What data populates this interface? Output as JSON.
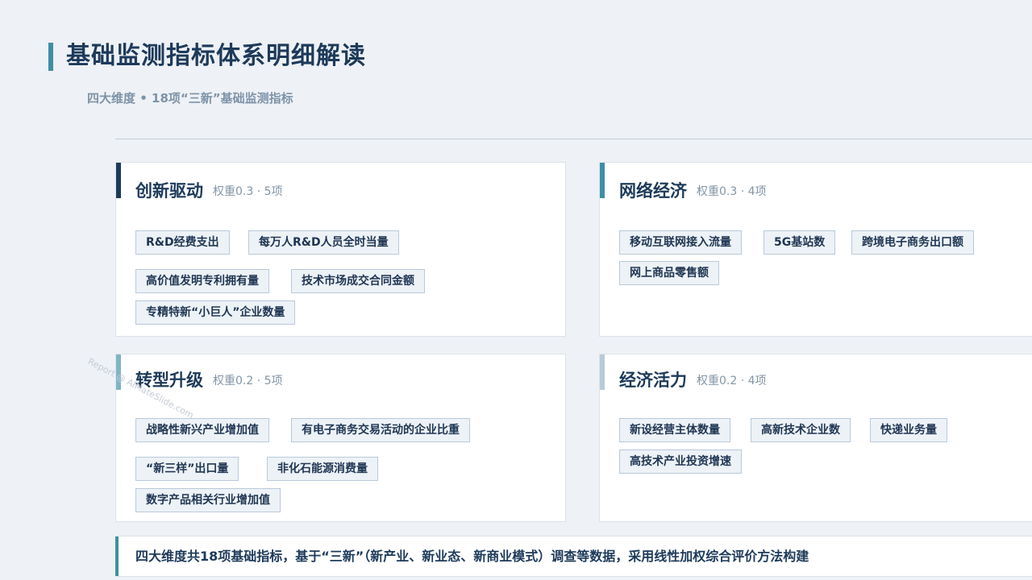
{
  "header": {
    "title": "基础监测指标体系明细解读",
    "subtitle": "四大维度 • 18项“三新”基础监测指标"
  },
  "colors": {
    "accent_teal": "#3e8fa5",
    "accent_navy": "#1d3a5a",
    "accent_light_teal": "#7fb6c6",
    "accent_pale": "#b9cad7",
    "tag_bg": "#edf2f7",
    "tag_border": "#b9c9da"
  },
  "cards": [
    {
      "title": "创新驱动",
      "meta": "权重0.3 · 5项",
      "tags": [
        "R&D经费支出",
        "每万人R&D人员全时当量",
        "高价值发明专利拥有量",
        "技术市场成交合同金额",
        "专精特新“小巨人”企业数量"
      ]
    },
    {
      "title": "网络经济",
      "meta": "权重0.3 · 4项",
      "tags": [
        "移动互联网接入流量",
        "5G基站数",
        "跨境电子商务出口额",
        "网上商品零售额"
      ]
    },
    {
      "title": "转型升级",
      "meta": "权重0.2 · 5项",
      "tags": [
        "战略性新兴产业增加值",
        "有电子商务交易活动的企业比重",
        "“新三样”出口量",
        "非化石能源消费量",
        "数字产品相关行业增加值"
      ]
    },
    {
      "title": "经济活力",
      "meta": "权重0.2 · 4项",
      "tags": [
        "新设经营主体数量",
        "高新技术企业数",
        "快递业务量",
        "高技术产业投资增速"
      ]
    }
  ],
  "footer": {
    "text": "四大维度共18项基础指标，基于“三新”（新产业、新业态、新商业模式）调查等数据，采用线性加权综合评价方法构建"
  },
  "watermark": "Report @ AIMateSlide.com"
}
